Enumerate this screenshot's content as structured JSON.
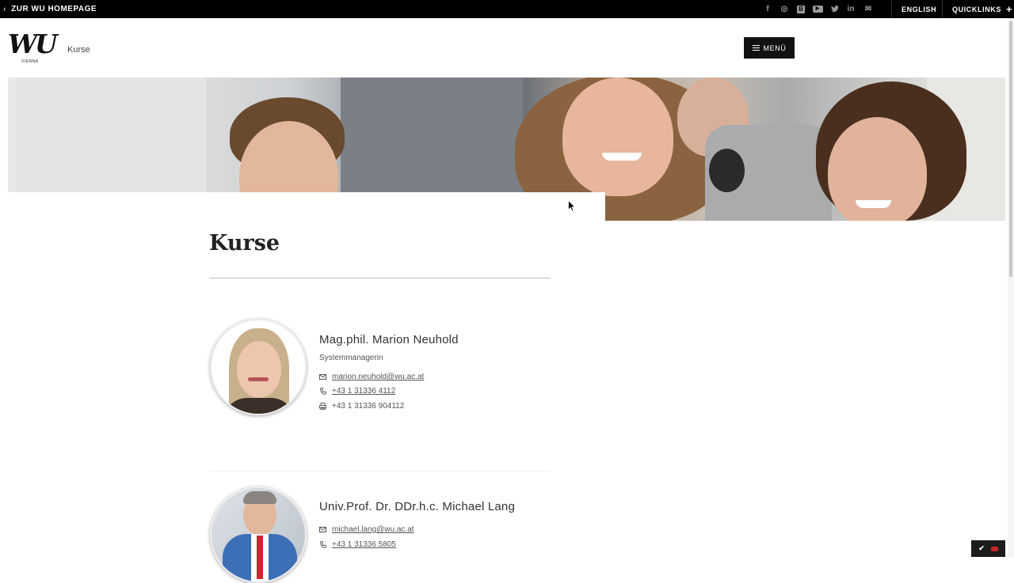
{
  "topbar": {
    "back_label": "ZUR WU HOMEPAGE",
    "english_label": "ENGLISH",
    "quicklinks_label": "QUICKLINKS",
    "social": [
      {
        "icon": "facebook-icon",
        "glyph": "f"
      },
      {
        "icon": "instagram-icon",
        "glyph": "◎"
      },
      {
        "icon": "blog-icon",
        "glyph": "B"
      },
      {
        "icon": "youtube-icon",
        "glyph": "▶"
      },
      {
        "icon": "twitter-icon",
        "glyph": "🐦"
      },
      {
        "icon": "linkedin-icon",
        "glyph": "in"
      },
      {
        "icon": "newsletter-icon",
        "glyph": "✉"
      }
    ]
  },
  "header": {
    "logo_text": "WU",
    "logo_sub": "VIENNA",
    "site_name": "Kurse",
    "menu_label": "MENÜ"
  },
  "page": {
    "title": "Kurse"
  },
  "people": [
    {
      "name": "Mag.phil. Marion Neuhold",
      "role": "Systemmanagerin",
      "email": "marion.neuhold@wu.ac.at",
      "phone": "+43 1 31336 4112",
      "fax": "+43 1 31336 904112"
    },
    {
      "name": "Univ.Prof. Dr. DDr.h.c. Michael Lang",
      "email": "michael.lang@wu.ac.at",
      "phone": "+43 1 31336 5805"
    }
  ],
  "colors": {
    "topbar_bg": "#000000",
    "menu_bg": "#111111",
    "text": "#333333"
  }
}
